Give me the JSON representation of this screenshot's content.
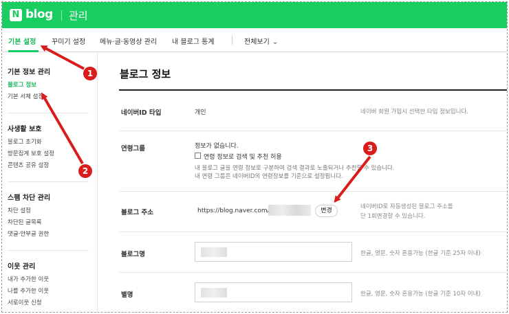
{
  "header": {
    "logo_mark": "N",
    "logo_text": "blog",
    "title": "관리"
  },
  "tabs": [
    {
      "label": "기본 설정",
      "active": true
    },
    {
      "label": "꾸미기 설정"
    },
    {
      "label": "메뉴·글·동영상 관리"
    },
    {
      "label": "내 블로그 통계"
    },
    {
      "label": "전체보기"
    }
  ],
  "sidebar": {
    "groups": [
      {
        "title": "기본 정보 관리",
        "items": [
          "블로그 정보",
          "기본 서체 설정"
        ]
      },
      {
        "title": "사생활 보호",
        "items": [
          "블로그 초기화",
          "방문집계 보호 설정",
          "콘텐츠 공유 설정"
        ]
      },
      {
        "title": "스팸 차단 관리",
        "items": [
          "차단 설정",
          "차단된 글목록",
          "댓글·안부글 권한"
        ]
      },
      {
        "title": "이웃 관리",
        "items": [
          "내가 추가한 이웃",
          "나를 추가한 이웃",
          "서로이웃 신청"
        ]
      }
    ]
  },
  "main": {
    "title": "블로그 정보",
    "naverid_type": {
      "label": "네이버ID 타입",
      "value": "개인",
      "help": "네이버 회원 가입시 선택한 타입 정보입니다."
    },
    "linked_group": {
      "label": "연령그룹",
      "value": "정보가 없습니다.",
      "checkbox_label": "연령 정보로 검색 및 추천 허용",
      "desc1": "내 블로그 글을 연령 정보로 구분하여 검색 결과로 노출되거나 추천할 수 있습니다.",
      "desc2": "내 연령 그룹은 네이버ID의 연령정보를 기준으로 설정됩니다."
    },
    "blog_address": {
      "label": "블로그 주소",
      "url_prefix": "https://blog.naver.com/",
      "change_button": "변경",
      "help1": "네이버ID로 자동생성된 블로그 주소를",
      "help2": "단 1회변경할 수 있습니다."
    },
    "blog_name": {
      "label": "블로그명",
      "help": "한글, 영문, 숫자 혼용가능 (한글 기준 25자 이내)"
    },
    "nickname": {
      "label": "별명",
      "help": "한글, 영문, 숫자 혼용가능 (한글 기준 10자 이내)"
    }
  },
  "annotations": {
    "badges": [
      "1",
      "2",
      "3"
    ],
    "color": "#d91c1c"
  },
  "colors": {
    "brand_green": "#19ce60",
    "active_green": "#19b75a"
  }
}
